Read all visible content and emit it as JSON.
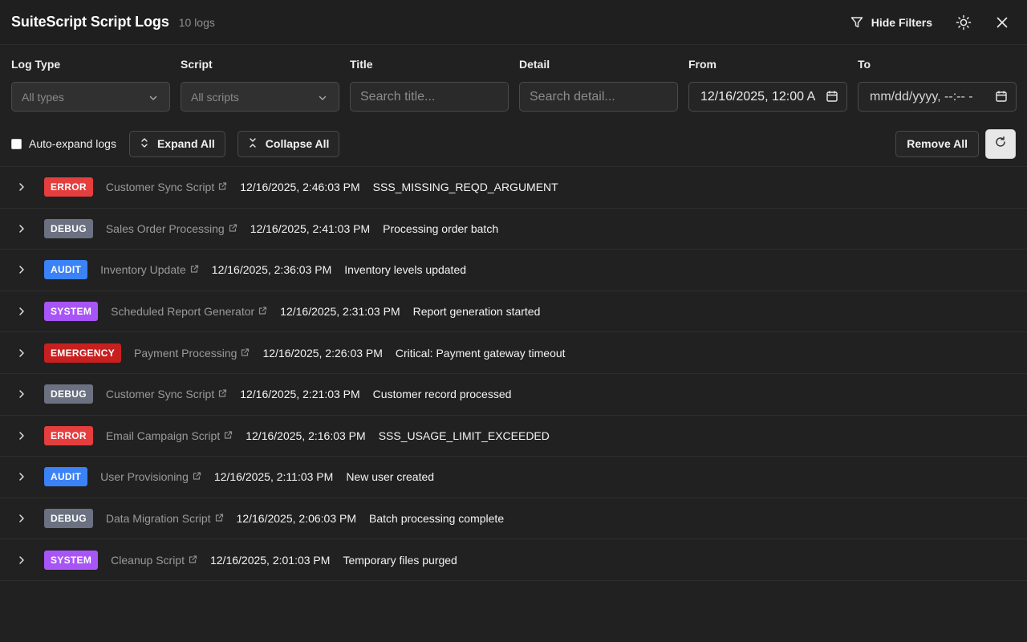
{
  "header": {
    "title": "SuiteScript Script Logs",
    "count": "10 logs",
    "hide_filters_label": "Hide Filters"
  },
  "filters": {
    "log_type": {
      "label": "Log Type",
      "value": "All types"
    },
    "script": {
      "label": "Script",
      "value": "All scripts"
    },
    "title": {
      "label": "Title",
      "placeholder": "Search title..."
    },
    "detail": {
      "label": "Detail",
      "placeholder": "Search detail..."
    },
    "from": {
      "label": "From",
      "value": "12/16/2025, 12:00 A"
    },
    "to": {
      "label": "To",
      "value": "mm/dd/yyyy, --:-- -"
    }
  },
  "toolbar": {
    "auto_expand_label": "Auto-expand logs",
    "expand_all_label": "Expand All",
    "collapse_all_label": "Collapse All",
    "remove_all_label": "Remove All"
  },
  "level_colors": {
    "ERROR": "#e53e3e",
    "DEBUG": "#6b7181",
    "AUDIT": "#3b82f6",
    "SYSTEM": "#a855f7",
    "EMERGENCY": "#c8201f"
  },
  "logs": [
    {
      "level": "ERROR",
      "script": "Customer Sync Script",
      "timestamp": "12/16/2025, 2:46:03 PM",
      "message": "SSS_MISSING_REQD_ARGUMENT"
    },
    {
      "level": "DEBUG",
      "script": "Sales Order Processing",
      "timestamp": "12/16/2025, 2:41:03 PM",
      "message": "Processing order batch"
    },
    {
      "level": "AUDIT",
      "script": "Inventory Update",
      "timestamp": "12/16/2025, 2:36:03 PM",
      "message": "Inventory levels updated"
    },
    {
      "level": "SYSTEM",
      "script": "Scheduled Report Generator",
      "timestamp": "12/16/2025, 2:31:03 PM",
      "message": "Report generation started"
    },
    {
      "level": "EMERGENCY",
      "script": "Payment Processing",
      "timestamp": "12/16/2025, 2:26:03 PM",
      "message": "Critical: Payment gateway timeout"
    },
    {
      "level": "DEBUG",
      "script": "Customer Sync Script",
      "timestamp": "12/16/2025, 2:21:03 PM",
      "message": "Customer record processed"
    },
    {
      "level": "ERROR",
      "script": "Email Campaign Script",
      "timestamp": "12/16/2025, 2:16:03 PM",
      "message": "SSS_USAGE_LIMIT_EXCEEDED"
    },
    {
      "level": "AUDIT",
      "script": "User Provisioning",
      "timestamp": "12/16/2025, 2:11:03 PM",
      "message": "New user created"
    },
    {
      "level": "DEBUG",
      "script": "Data Migration Script",
      "timestamp": "12/16/2025, 2:06:03 PM",
      "message": "Batch processing complete"
    },
    {
      "level": "SYSTEM",
      "script": "Cleanup Script",
      "timestamp": "12/16/2025, 2:01:03 PM",
      "message": "Temporary files purged"
    }
  ],
  "icons": {
    "filter": "filter-icon",
    "theme": "sun-icon",
    "close": "close-icon",
    "expand_all": "chevrons-expand-icon",
    "collapse_all": "chevrons-collapse-icon",
    "refresh": "refresh-icon",
    "row_expander": "chevron-right-icon",
    "script_link": "external-link-icon",
    "calendar": "calendar-icon"
  }
}
